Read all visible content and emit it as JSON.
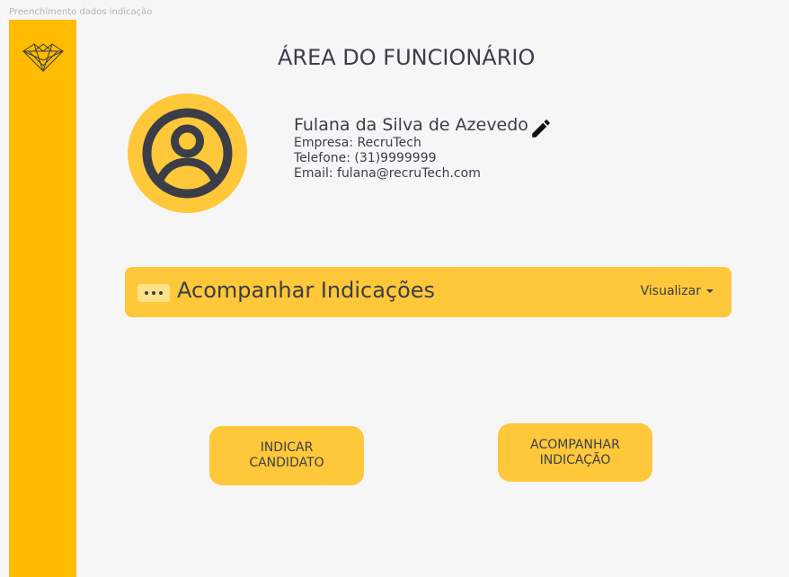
{
  "frame_label": "Preenchimento dados indicação",
  "sidebar": {
    "logo_icon": "triangle-logo-icon",
    "color": "#ffbb00"
  },
  "header": {
    "title": "ÁREA DO FUNCIONÁRIO"
  },
  "profile": {
    "avatar_icon": "user-circle-icon",
    "name": "Fulana da Silva de Azevedo",
    "edit_icon": "pencil-icon",
    "company": "Empresa: RecruTech",
    "phone": "Telefone: (31)9999999",
    "email": "Email: fulana@recruTech.com"
  },
  "accordion": {
    "menu_icon": "more-dots-icon",
    "title": "Acompanhar Indicações",
    "view_label": "Visualizar",
    "view_icon": "caret-down-icon"
  },
  "actions": {
    "indicate_line1": "INDICAR",
    "indicate_line2": "CANDIDATO",
    "follow_line1": "ACOMPANHAR",
    "follow_line2": "INDICAÇÃO"
  },
  "colors": {
    "accent": "#ffc83a",
    "sidebar": "#ffbb00",
    "background": "#f6f6f6",
    "text": "#3b3e48"
  }
}
